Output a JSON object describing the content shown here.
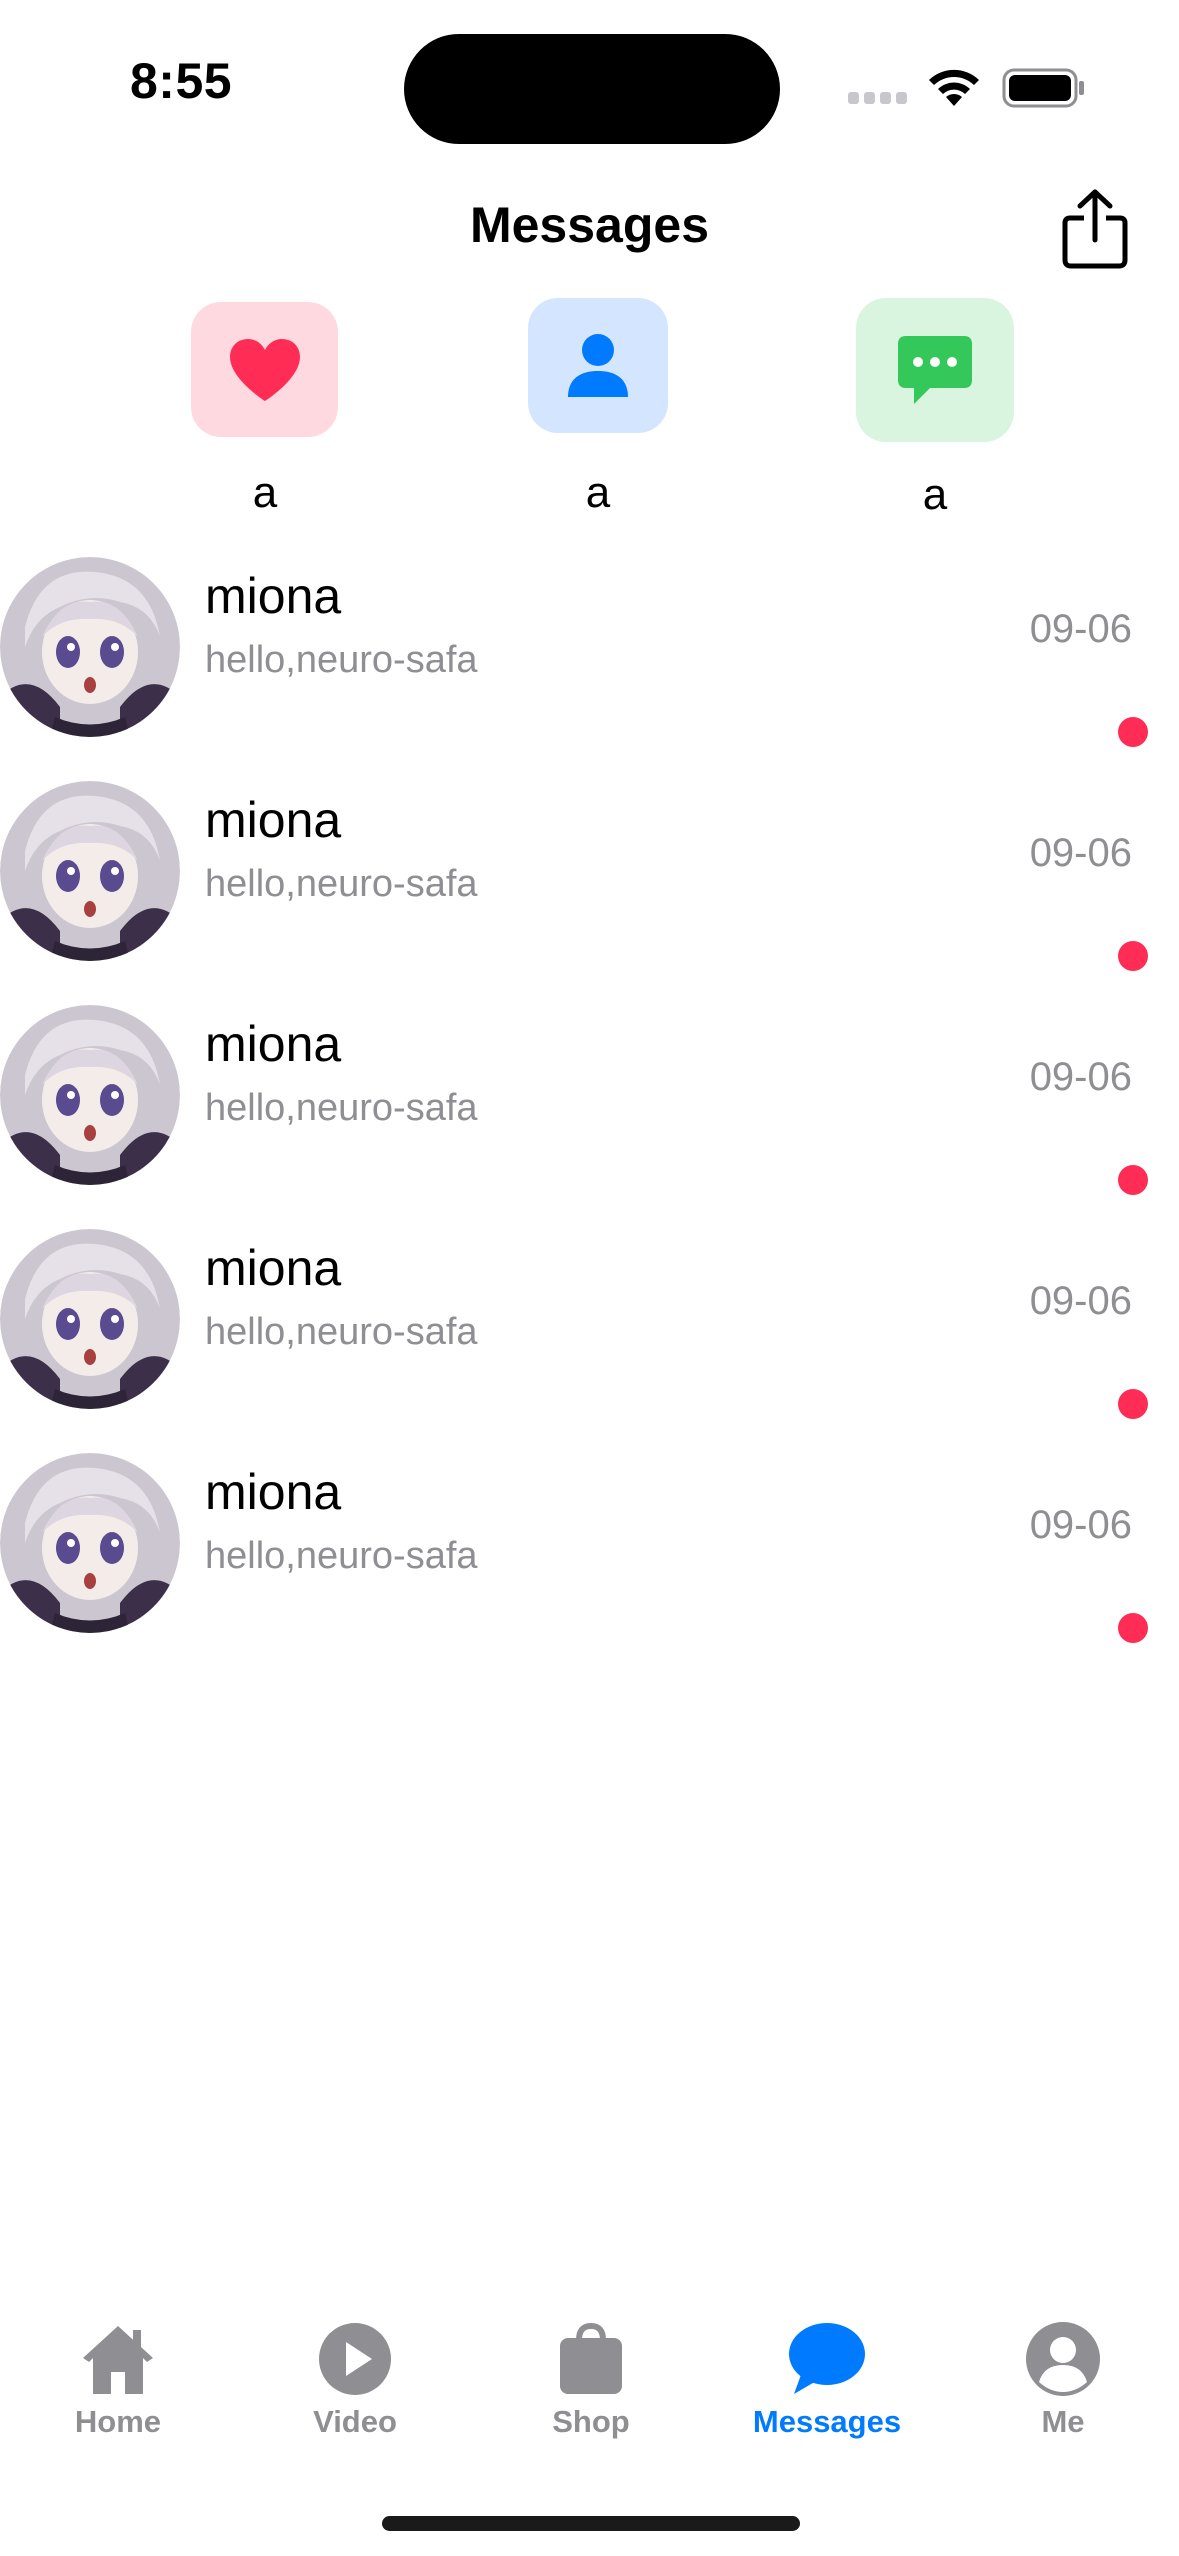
{
  "status_bar": {
    "time": "8:55"
  },
  "header": {
    "title": "Messages"
  },
  "quick_actions": [
    {
      "label": "a",
      "icon": "heart-icon",
      "tile_color": "#ffd9e0",
      "icon_color": "#ff2d55"
    },
    {
      "label": "a",
      "icon": "person-icon",
      "tile_color": "#d4e6ff",
      "icon_color": "#007aff"
    },
    {
      "label": "a",
      "icon": "chat-bubble-icon",
      "tile_color": "#d9f5df",
      "icon_color": "#34c759"
    }
  ],
  "messages": [
    {
      "name": "miona",
      "preview": "hello,neuro-safa",
      "time": "09-06",
      "unread": true
    },
    {
      "name": "miona",
      "preview": "hello,neuro-safa",
      "time": "09-06",
      "unread": true
    },
    {
      "name": "miona",
      "preview": "hello,neuro-safa",
      "time": "09-06",
      "unread": true
    },
    {
      "name": "miona",
      "preview": "hello,neuro-safa",
      "time": "09-06",
      "unread": true
    },
    {
      "name": "miona",
      "preview": "hello,neuro-safa",
      "time": "09-06",
      "unread": true
    }
  ],
  "tab_bar": {
    "tabs": [
      {
        "label": "Home",
        "icon": "house-icon",
        "active": false
      },
      {
        "label": "Video",
        "icon": "play-icon",
        "active": false
      },
      {
        "label": "Shop",
        "icon": "shopping-bag-icon",
        "active": false
      },
      {
        "label": "Messages",
        "icon": "chat-bubble-icon",
        "active": true
      },
      {
        "label": "Me",
        "icon": "person-circle-icon",
        "active": false
      }
    ]
  },
  "colors": {
    "accent": "#007aff",
    "inactive": "#8e8e93",
    "unread_dot": "#ff2d55"
  }
}
